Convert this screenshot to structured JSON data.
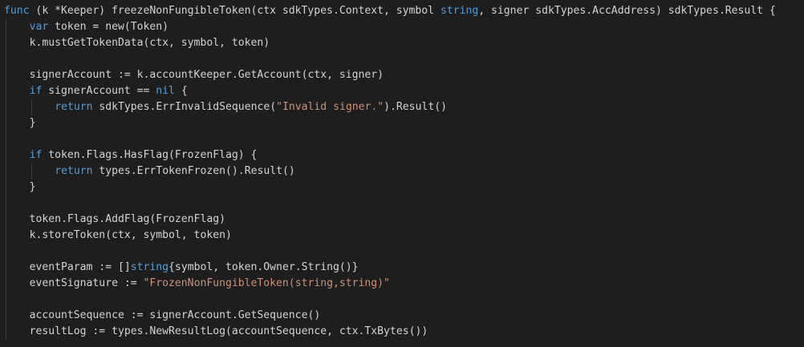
{
  "editor": {
    "background": "#1e1e1e",
    "colors": {
      "keyword": "#569cd6",
      "string": "#ce9178",
      "default": "#d4d4d4"
    },
    "lines": [
      {
        "indent": 0,
        "tokens": [
          {
            "t": "kw",
            "text": "func"
          },
          {
            "t": "def",
            "text": " (k *Keeper) freezeNonFungibleToken(ctx sdkTypes.Context, symbol "
          },
          {
            "t": "kw",
            "text": "string"
          },
          {
            "t": "def",
            "text": ", signer sdkTypes.AccAddress) sdkTypes.Result {"
          }
        ]
      },
      {
        "indent": 1,
        "tokens": [
          {
            "t": "kw",
            "text": "var"
          },
          {
            "t": "def",
            "text": " token = new(Token)"
          }
        ]
      },
      {
        "indent": 1,
        "tokens": [
          {
            "t": "def",
            "text": "k.mustGetTokenData(ctx, symbol, token)"
          }
        ]
      },
      {
        "indent": 1,
        "tokens": []
      },
      {
        "indent": 1,
        "tokens": [
          {
            "t": "def",
            "text": "signerAccount := k.accountKeeper.GetAccount(ctx, signer)"
          }
        ]
      },
      {
        "indent": 1,
        "tokens": [
          {
            "t": "kw",
            "text": "if"
          },
          {
            "t": "def",
            "text": " signerAccount == "
          },
          {
            "t": "kw",
            "text": "nil"
          },
          {
            "t": "def",
            "text": " {"
          }
        ]
      },
      {
        "indent": 2,
        "tokens": [
          {
            "t": "kw",
            "text": "return"
          },
          {
            "t": "def",
            "text": " sdkTypes.ErrInvalidSequence("
          },
          {
            "t": "str",
            "text": "\"Invalid signer.\""
          },
          {
            "t": "def",
            "text": ").Result()"
          }
        ]
      },
      {
        "indent": 1,
        "tokens": [
          {
            "t": "def",
            "text": "}"
          }
        ]
      },
      {
        "indent": 1,
        "tokens": []
      },
      {
        "indent": 1,
        "tokens": [
          {
            "t": "kw",
            "text": "if"
          },
          {
            "t": "def",
            "text": " token.Flags.HasFlag(FrozenFlag) {"
          }
        ]
      },
      {
        "indent": 2,
        "tokens": [
          {
            "t": "kw",
            "text": "return"
          },
          {
            "t": "def",
            "text": " types.ErrTokenFrozen().Result()"
          }
        ]
      },
      {
        "indent": 1,
        "tokens": [
          {
            "t": "def",
            "text": "}"
          }
        ]
      },
      {
        "indent": 1,
        "tokens": []
      },
      {
        "indent": 1,
        "tokens": [
          {
            "t": "def",
            "text": "token.Flags.AddFlag(FrozenFlag)"
          }
        ]
      },
      {
        "indent": 1,
        "tokens": [
          {
            "t": "def",
            "text": "k.storeToken(ctx, symbol, token)"
          }
        ]
      },
      {
        "indent": 1,
        "tokens": []
      },
      {
        "indent": 1,
        "tokens": [
          {
            "t": "def",
            "text": "eventParam := []"
          },
          {
            "t": "kw",
            "text": "string"
          },
          {
            "t": "def",
            "text": "{symbol, token.Owner.String()}"
          }
        ]
      },
      {
        "indent": 1,
        "tokens": [
          {
            "t": "def",
            "text": "eventSignature := "
          },
          {
            "t": "str",
            "text": "\"FrozenNonFungibleToken(string,string)\""
          }
        ]
      },
      {
        "indent": 1,
        "tokens": []
      },
      {
        "indent": 1,
        "tokens": [
          {
            "t": "def",
            "text": "accountSequence := signerAccount.GetSequence()"
          }
        ]
      },
      {
        "indent": 1,
        "tokens": [
          {
            "t": "def",
            "text": "resultLog := types.NewResultLog(accountSequence, ctx.TxBytes())"
          }
        ]
      }
    ]
  }
}
